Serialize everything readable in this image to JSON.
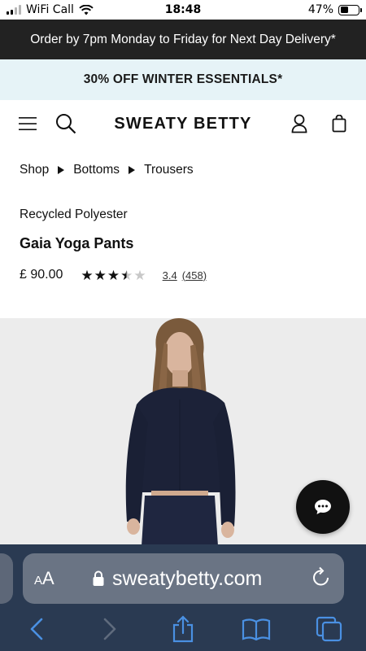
{
  "status_bar": {
    "carrier": "WiFi Call",
    "time": "18:48",
    "battery_percent": "47%",
    "battery_level": 0.47
  },
  "promo": {
    "delivery": "Order by 7pm Monday to Friday for Next Day Delivery*",
    "sale": "30% OFF WINTER ESSENTIALS*"
  },
  "header": {
    "logo": "SWEATY BETTY",
    "icons": [
      "menu-icon",
      "search-icon",
      "account-icon",
      "bag-icon"
    ]
  },
  "breadcrumb": [
    "Shop",
    "Bottoms",
    "Trousers"
  ],
  "product": {
    "material": "Recycled Polyester",
    "name": "Gaia Yoga Pants",
    "price": "£ 90.00",
    "rating": "3.4",
    "review_count": "(458)",
    "rating_value": 3.4,
    "rating_max": 5
  },
  "chat": {
    "icon": "chat-bubble-icon"
  },
  "safari": {
    "text_size_label": "AA",
    "url": "sweatybetty.com",
    "toolbar": [
      "back-icon",
      "forward-icon",
      "share-icon",
      "bookmarks-icon",
      "tabs-icon"
    ]
  },
  "colors": {
    "promo_dark_bg": "#222222",
    "promo_light_bg": "#e6f3f7",
    "safari_bar": "#2a3a52",
    "safari_link": "#4a90e2"
  }
}
